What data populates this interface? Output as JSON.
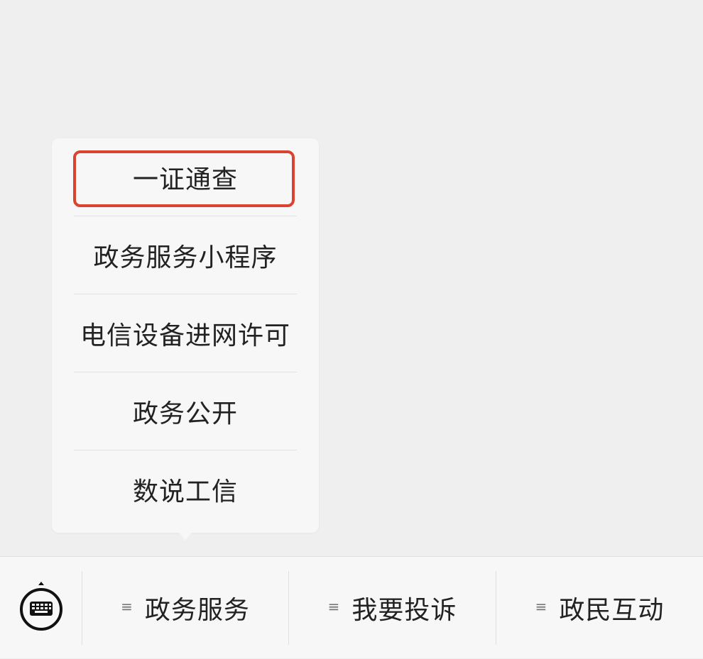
{
  "popup_menu": {
    "items": [
      {
        "label": "一证通查"
      },
      {
        "label": "政务服务小程序"
      },
      {
        "label": "电信设备进网许可"
      },
      {
        "label": "政务公开"
      },
      {
        "label": "数说工信"
      }
    ],
    "highlight_color": "#d9432f"
  },
  "bottom_bar": {
    "keyboard_icon": "keyboard-icon",
    "tabs": [
      {
        "label": "政务服务",
        "icon": "menu-lines-icon"
      },
      {
        "label": "我要投诉",
        "icon": "menu-lines-icon"
      },
      {
        "label": "政民互动",
        "icon": "menu-lines-icon"
      }
    ]
  }
}
